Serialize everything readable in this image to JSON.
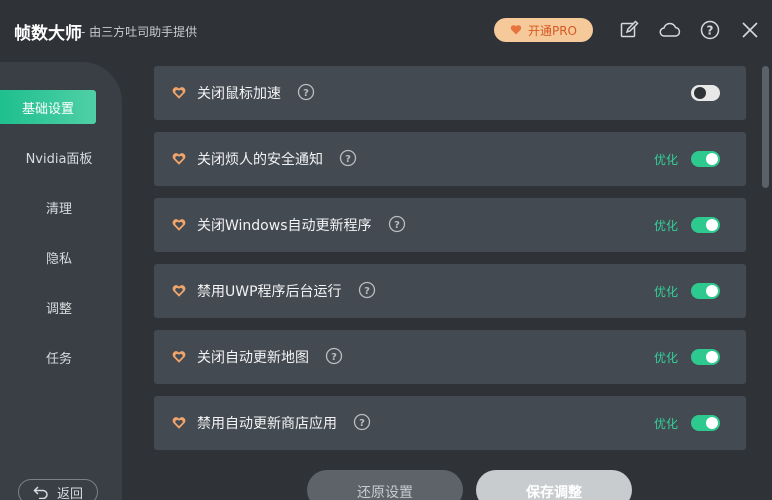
{
  "header": {
    "app_title": "帧数大师",
    "app_subtitle": "- 由三方吐司助手提供",
    "pro_button_label": "开通PRO"
  },
  "sidebar": {
    "items": [
      {
        "label": "基础设置",
        "active": true
      },
      {
        "label": "Nvidia面板",
        "active": false
      },
      {
        "label": "清理",
        "active": false
      },
      {
        "label": "隐私",
        "active": false
      },
      {
        "label": "调整",
        "active": false
      },
      {
        "label": "任务",
        "active": false
      }
    ],
    "back_label": "返回"
  },
  "settings": [
    {
      "label": "关闭鼠标加速",
      "status": "",
      "enabled": false
    },
    {
      "label": "关闭烦人的安全通知",
      "status": "优化",
      "enabled": true
    },
    {
      "label": "关闭Windows自动更新程序",
      "status": "优化",
      "enabled": true
    },
    {
      "label": "禁用UWP程序后台运行",
      "status": "优化",
      "enabled": true
    },
    {
      "label": "关闭自动更新地图",
      "status": "优化",
      "enabled": true
    },
    {
      "label": "禁用自动更新商店应用",
      "status": "优化",
      "enabled": true
    }
  ],
  "footer": {
    "restore_label": "还原设置",
    "save_label": "保存调整"
  },
  "colors": {
    "accent_green": "#2ec98f",
    "pro_orange": "#f6c99a",
    "heart_orange": "#f2a56b"
  }
}
